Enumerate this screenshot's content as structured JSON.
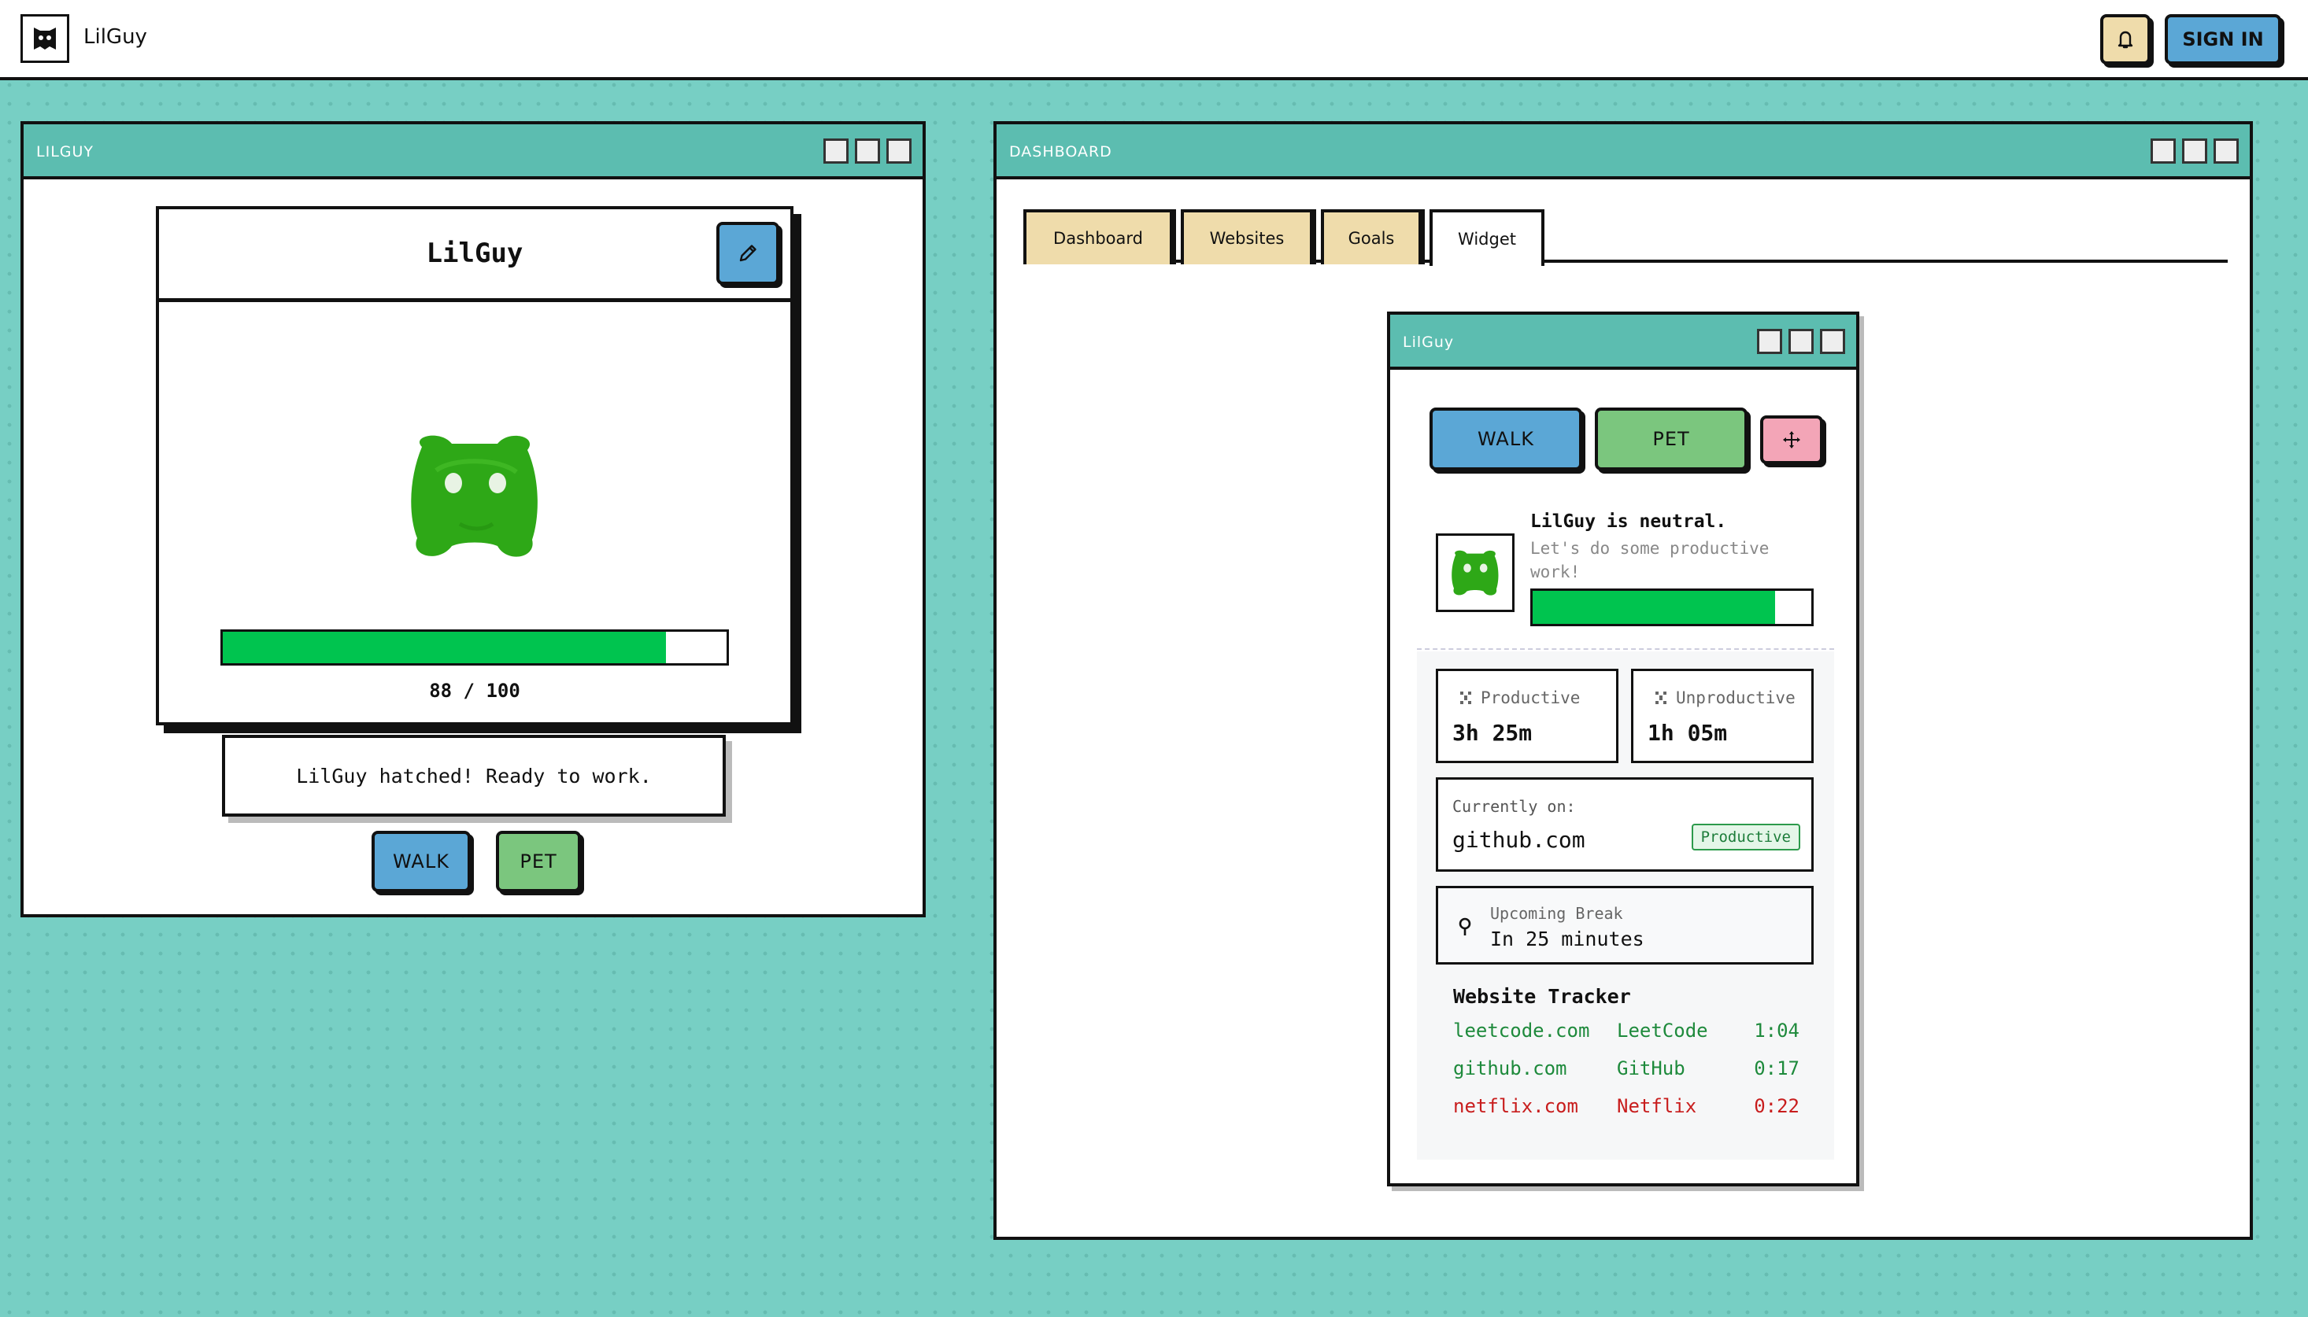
{
  "app": {
    "title": "LilGuy"
  },
  "header": {
    "signin_label": "SIGN IN"
  },
  "left_window": {
    "title": "LILGUY",
    "pet_name": "LilGuy",
    "health": {
      "current": 88,
      "max": 100,
      "text": "88 / 100"
    },
    "message": "LilGuy hatched! Ready to work.",
    "walk_label": "WALK",
    "pet_label": "PET"
  },
  "right_window": {
    "title": "DASHBOARD",
    "tabs": [
      {
        "label": "Dashboard"
      },
      {
        "label": "Websites"
      },
      {
        "label": "Goals"
      },
      {
        "label": "Widget"
      }
    ],
    "active_tab": "Widget"
  },
  "widget": {
    "title": "LilGuy",
    "walk_label": "WALK",
    "pet_label": "PET",
    "mood": {
      "title": "LilGuy is neutral.",
      "subtitle": "Let's do some productive work!",
      "level_percent": 87
    },
    "productive": {
      "label": "Productive",
      "value": "3h 25m"
    },
    "unproductive": {
      "label": "Unproductive",
      "value": "1h 05m"
    },
    "current": {
      "label": "Currently on:",
      "site": "github.com",
      "status": "Productive"
    },
    "upcoming_break": {
      "label": "Upcoming Break",
      "value": "In 25 minutes"
    },
    "tracker": {
      "title": "Website Tracker",
      "rows": [
        {
          "domain": "leetcode.com",
          "name": "LeetCode",
          "time": "1:04",
          "status": "productive"
        },
        {
          "domain": "github.com",
          "name": "GitHub",
          "time": "0:17",
          "status": "productive"
        },
        {
          "domain": "netflix.com",
          "name": "Netflix",
          "time": "0:22",
          "status": "unproductive"
        }
      ]
    }
  },
  "colors": {
    "background": "#77cfc4",
    "titlebar": "#5cbdb0",
    "button_blue": "#5ba7d6",
    "button_green": "#7bc67e",
    "button_pink": "#f3a5b7",
    "tab_inactive": "#efdcab",
    "progress_green": "#00c44f",
    "productive_text": "#1e8a3c",
    "unproductive_text": "#c81d1d"
  },
  "icons": {
    "logo": "lilguy-logo-icon",
    "bell": "bell-icon",
    "edit": "pencil-icon",
    "move": "move-icon",
    "productive": "productive-icon",
    "unproductive": "unproductive-icon",
    "break": "timer-icon"
  }
}
